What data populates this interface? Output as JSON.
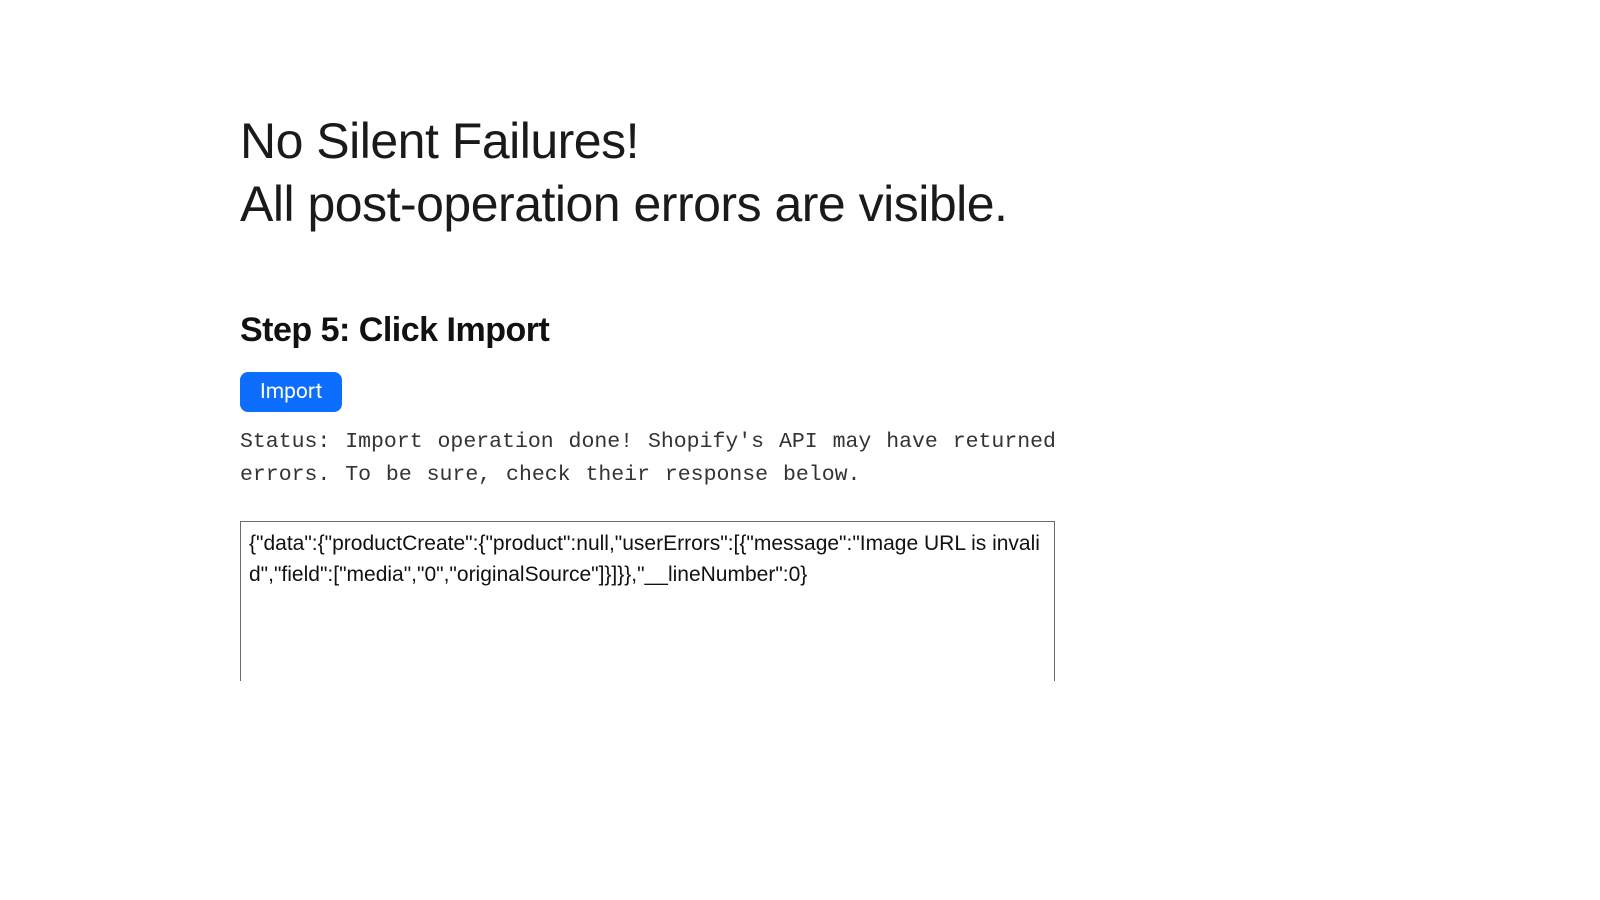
{
  "headline": {
    "line1": "No Silent Failures!",
    "line2": "All post-operation errors are visible."
  },
  "step": {
    "heading": "Step 5: Click Import",
    "button_label": "Import",
    "status_text": "Status: Import operation done! Shopify's API may have returned errors. To be sure, check their response below.",
    "response_body": "{\"data\":{\"productCreate\":{\"product\":null,\"userErrors\":[{\"message\":\"Image URL is invalid\",\"field\":[\"media\",\"0\",\"originalSource\"]}]}},\"__lineNumber\":0}"
  },
  "colors": {
    "button_bg": "#0d6efd",
    "button_fg": "#ffffff",
    "text": "#111111",
    "border": "#6b6b6b"
  }
}
